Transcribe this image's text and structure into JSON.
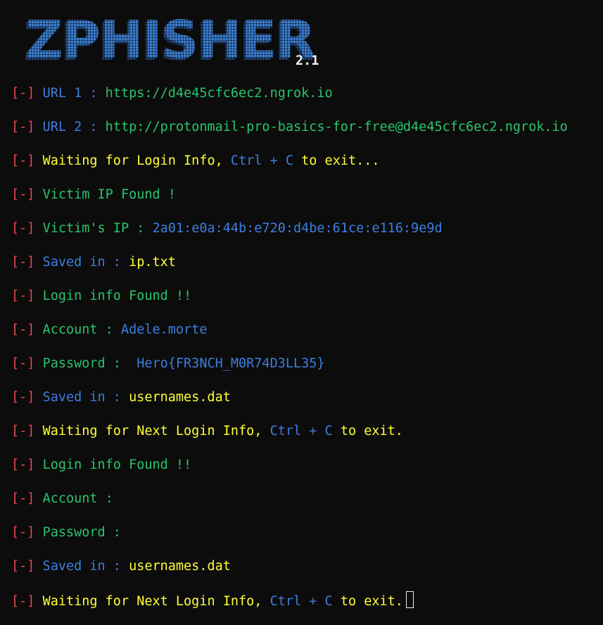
{
  "banner": {
    "logo": "ZPHISHER",
    "version": "2.1"
  },
  "prefix": "[-]",
  "lines": {
    "url1_label": "URL 1 : ",
    "url1_value": "https://d4e45cfc6ec2.ngrok.io",
    "url2_label": "URL 2 : ",
    "url2_value": "http://protonmail-pro-basics-for-free@d4e45cfc6ec2.ngrok.io",
    "wait1_a": "Waiting for Login Info,",
    "wait1_ctrl": "Ctrl + C",
    "wait1_b": "to exit...",
    "victim_found": "Victim IP Found !",
    "victim_ip_label": "Victim's IP : ",
    "victim_ip_value": "2a01:e0a:44b:e720:d4be:61ce:e116:9e9d",
    "saved1_label": "Saved in : ",
    "saved1_value": "ip.txt",
    "login_found1": "Login info Found !!",
    "account1_label": "Account : ",
    "account1_value": "Adele.morte",
    "password1_label": "Password :  ",
    "password1_value": "Hero{FR3NCH_M0R74D3LL35}",
    "saved2_label": "Saved in : ",
    "saved2_value": "usernames.dat",
    "wait2_a": "Waiting for Next Login Info,",
    "wait2_ctrl": "Ctrl + C",
    "wait2_b": "to exit.",
    "login_found2": "Login info Found !!",
    "account2_label": "Account :",
    "password2_label": "Password :",
    "saved3_label": "Saved in : ",
    "saved3_value": "usernames.dat",
    "wait3_a": "Waiting for Next Login Info,",
    "wait3_ctrl": "Ctrl + C",
    "wait3_b": "to exit."
  },
  "colors": {
    "background": "#0c0c0c",
    "prefix": "#e74856",
    "label_blue": "#3d7ee0",
    "label_green": "#29c56b",
    "highlight_yellow": "#ffff33",
    "logo_blue": "#3a80d6"
  }
}
